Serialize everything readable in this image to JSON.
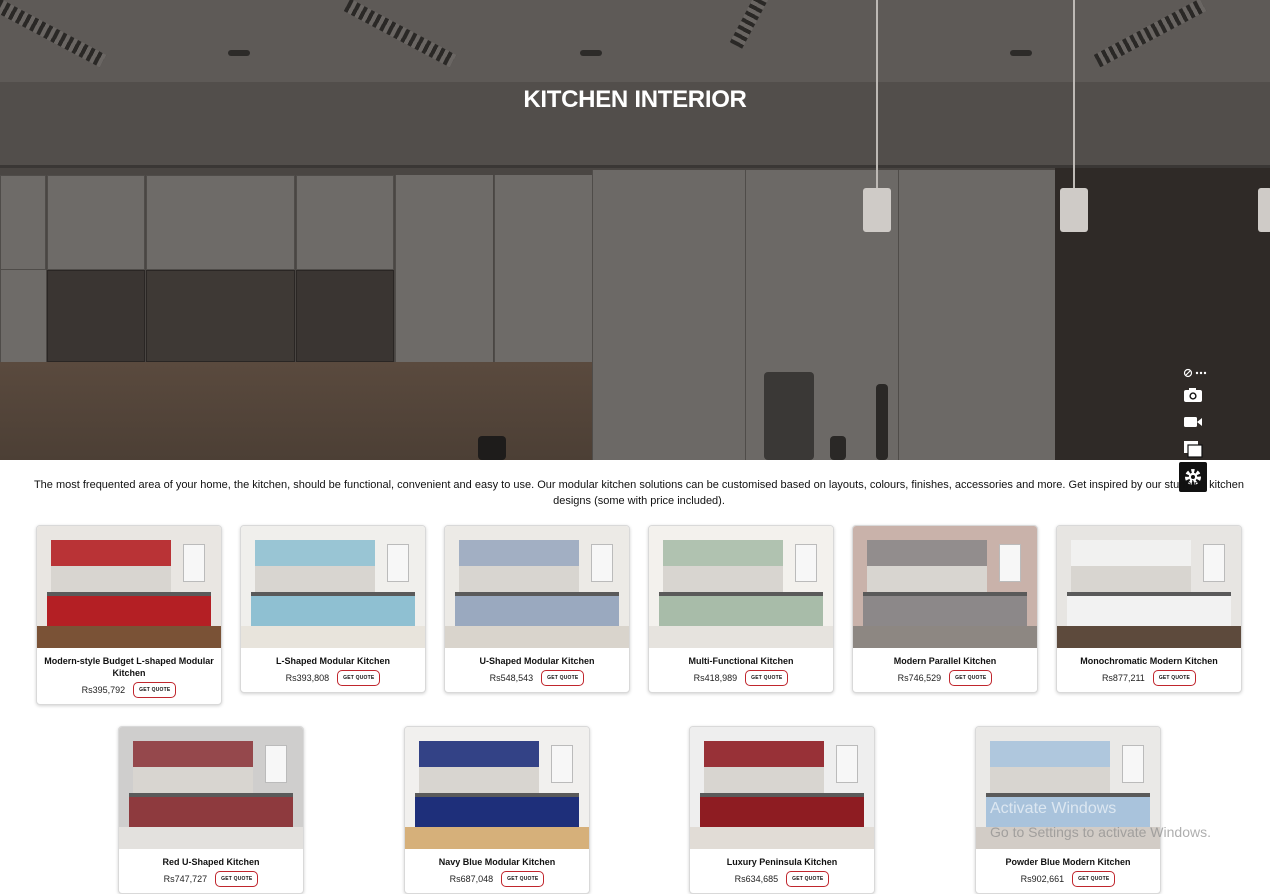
{
  "hero": {
    "title": "KITCHEN INTERIOR"
  },
  "toolbar": {
    "icons": [
      "share-icon",
      "more-icon",
      "camera-icon",
      "video-icon",
      "gallery-icon",
      "settings-icon"
    ]
  },
  "intro": {
    "text": "The most frequented area of your home, the kitchen, should be functional, convenient and easy to use. Our modular kitchen solutions can be customised based on layouts, colours, finishes, accessories and more. Get inspired by our stunning kitchen designs (some with price included)."
  },
  "quote_label": "GET QUOTE",
  "products": [
    {
      "title": "Modern-style Budget L-shaped Modular Kitchen",
      "price": "Rs395,792",
      "accent": "#b41f24",
      "wall": "#e9e6e2",
      "floor": "#7a5236"
    },
    {
      "title": "L-Shaped Modular Kitchen",
      "price": "Rs393,808",
      "accent": "#8fc0d2",
      "wall": "#f0efec",
      "floor": "#e8e4dc"
    },
    {
      "title": "U-Shaped Modular Kitchen",
      "price": "Rs548,543",
      "accent": "#9aa9bf",
      "wall": "#eceae6",
      "floor": "#d9d4cc"
    },
    {
      "title": "Multi-Functional Kitchen",
      "price": "Rs418,989",
      "accent": "#a8bca9",
      "wall": "#f3f1ed",
      "floor": "#e6e3de"
    },
    {
      "title": "Modern Parallel Kitchen",
      "price": "Rs746,529",
      "accent": "#8c8889",
      "wall": "#c9b2aa",
      "floor": "#8d8782"
    },
    {
      "title": "Monochromatic Modern Kitchen",
      "price": "Rs877,211",
      "accent": "#f2f2f2",
      "wall": "#e7e5e2",
      "floor": "#5d4a3c"
    },
    {
      "title": "Red U-Shaped Kitchen",
      "price": "Rs747,727",
      "accent": "#8e3a3e",
      "wall": "#cfcecd",
      "floor": "#e3e1de"
    },
    {
      "title": "Navy Blue Modular Kitchen",
      "price": "Rs687,048",
      "accent": "#1e2f7a",
      "wall": "#f1f0ee",
      "floor": "#d6b07a"
    },
    {
      "title": "Luxury Peninsula Kitchen",
      "price": "Rs634,685",
      "accent": "#8e1c22",
      "wall": "#eeeeee",
      "floor": "#e1dcd6"
    },
    {
      "title": "Powder Blue Modern Kitchen",
      "price": "Rs902,661",
      "accent": "#a9c3dc",
      "wall": "#eae9e7",
      "floor": "#d2ccc6"
    }
  ],
  "watermark": {
    "line1": "Activate Windows",
    "line2": "Go to Settings to activate Windows."
  }
}
